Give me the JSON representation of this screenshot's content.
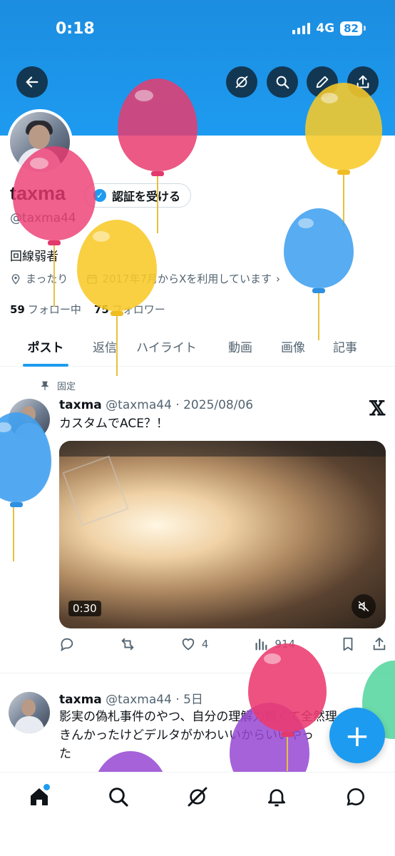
{
  "status_bar": {
    "time": "0:18",
    "network": "4G",
    "battery": "82"
  },
  "header_buttons": [
    "back",
    "grok",
    "search",
    "edit",
    "share"
  ],
  "profile": {
    "display_name": "taxma",
    "verify_label": "認証を受ける",
    "handle": "@taxma44",
    "bio": "回線弱者",
    "location": "まったり",
    "joined": "2017年7月からXを利用しています",
    "following_count": "59",
    "following_label": "フォロー中",
    "followers_count": "75",
    "followers_label": "フォロワー"
  },
  "tabs": [
    {
      "label": "ポスト",
      "active": true
    },
    {
      "label": "返信",
      "active": false
    },
    {
      "label": "ハイライト",
      "active": false
    },
    {
      "label": "動画",
      "active": false
    },
    {
      "label": "画像",
      "active": false
    },
    {
      "label": "記事",
      "active": false
    }
  ],
  "posts": [
    {
      "pinned_label": "固定",
      "name": "taxma",
      "handle_date": "@taxma44 · 2025/08/06",
      "text": "カスタムでACE？！",
      "video_duration": "0:30",
      "likes": "4",
      "views": "914"
    },
    {
      "name": "taxma",
      "handle_date": "@taxma44 · 5日",
      "text_lines": [
        "影実の偽札事件のやつ、自分の理解力無くて全然理",
        "きんかったけどデルタがかわいいからいいやっ",
        "た"
      ]
    }
  ],
  "fab_label": "+",
  "bottom_nav": [
    "home",
    "search",
    "grok",
    "notifications",
    "messages"
  ],
  "colors": {
    "accent": "#1d9bf0",
    "text": "#0f1419",
    "secondary": "#536471"
  }
}
